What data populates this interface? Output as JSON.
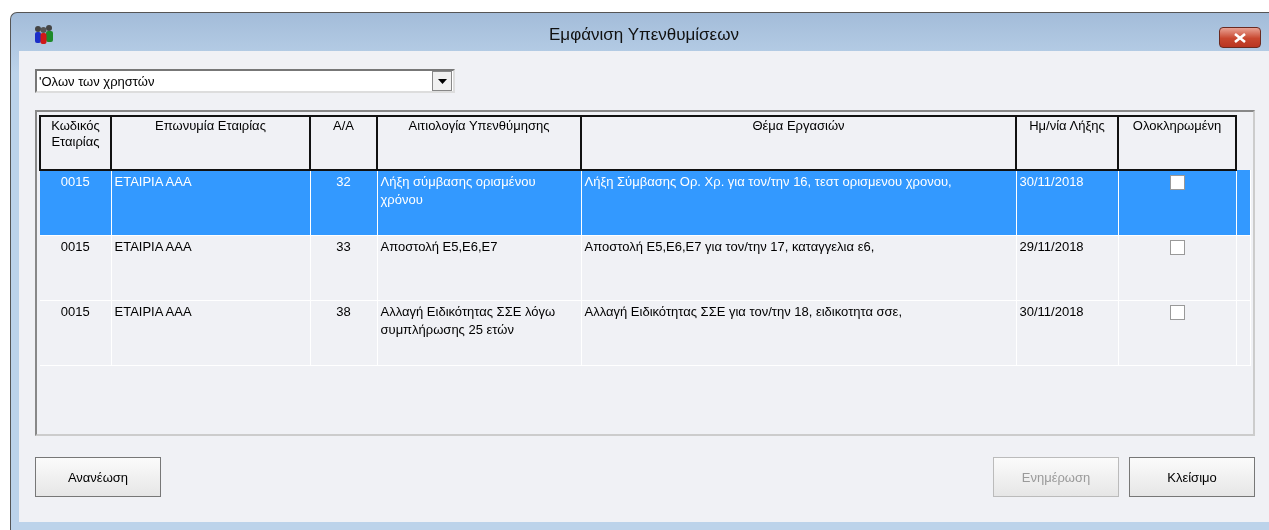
{
  "window": {
    "title": "Εμφάνιση Υπενθυμίσεων"
  },
  "filter": {
    "value": "'Ολων των χρηστών"
  },
  "table": {
    "columns": [
      "Κωδικός Εταιρίας",
      "Επωνυμία Εταιρίας",
      "Α/Α",
      "Αιτιολογία Υπενθύμησης",
      "Θέμα Εργασιών",
      "Ημ/νία Λήξης",
      "Ολοκληρωμένη"
    ],
    "rows": [
      {
        "selected": true,
        "completed": false,
        "cells": [
          "0015",
          "ΕΤΑΙΡΙΑ ΑΑΑ",
          "32",
          "Λήξη σύμβασης ορισμένου χρόνου",
          "Λήξη Σύμβασης Ορ. Χρ. για τον/την 16, τεστ ορισμενου χρονου,",
          "30/11/2018"
        ]
      },
      {
        "selected": false,
        "completed": false,
        "cells": [
          "0015",
          "ΕΤΑΙΡΙΑ ΑΑΑ",
          "33",
          "Αποστολή Ε5,Ε6,Ε7",
          "Αποστολή Ε5,Ε6,Ε7 για τον/την 17, καταγγελια ε6,",
          "29/11/2018"
        ]
      },
      {
        "selected": false,
        "completed": false,
        "cells": [
          "0015",
          "ΕΤΑΙΡΙΑ ΑΑΑ",
          "38",
          "Αλλαγή Ειδικότητας ΣΣΕ λόγω συμπλήρωσης 25 ετών",
          "Αλλαγή Ειδικότητας ΣΣΕ για τον/την 18, ειδικοτητα σσε,",
          "30/11/2018"
        ]
      }
    ]
  },
  "left_buttons": [
    {
      "label": "Ανανέωση",
      "disabled": false
    }
  ],
  "right_buttons": [
    {
      "label": "Ενημέρωση",
      "disabled": true
    },
    {
      "label": "Κλείσιμο",
      "disabled": false
    }
  ]
}
